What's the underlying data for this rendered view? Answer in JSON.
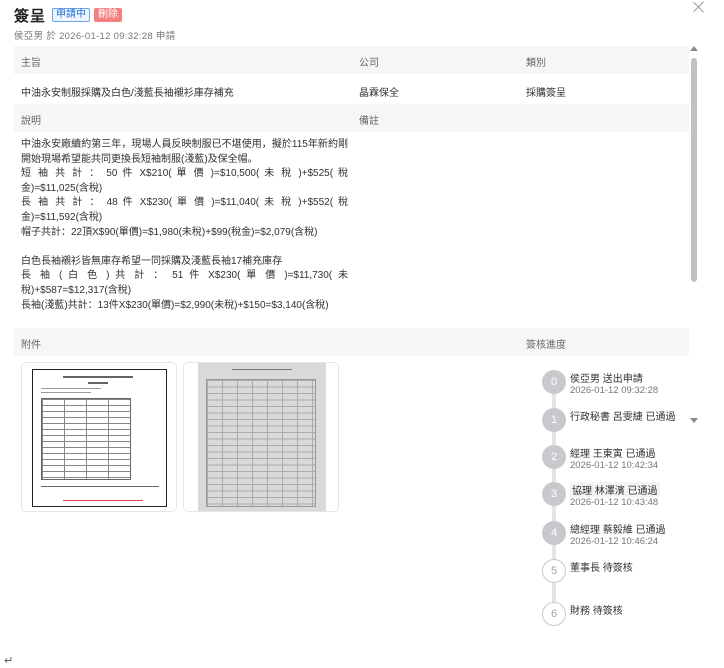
{
  "header": {
    "title": "簽呈",
    "status_tag": "申請中",
    "delete_label": "刪除",
    "subtitle": "侯亞男 於 2026-01-12 09:32:28 申請"
  },
  "info": {
    "subject_label": "主旨",
    "company_label": "公司",
    "category_label": "類別",
    "subject_value": "中油永安制服採購及白色/淺藍長袖襯衫庫存補充",
    "company_value": "晶霖保全",
    "category_value": "採購簽呈",
    "description_label": "說明",
    "remarks_label": "備註"
  },
  "description": {
    "lines": [
      "中油永安廠續約第三年，現場人員反映制服已不堪使用，擬於115年新約剛開始現場希望能共同更換長短袖制服(淺藍)及保全帽。",
      "短 袖 共 計 ： 50 件 X$210( 單 價 )=$10,500( 未 稅 )+$525( 稅 金)=$11,025(含稅)",
      "長 袖 共 計 ： 48 件 X$230( 單 價 )=$11,040( 未 稅 )+$552( 稅 金)=$11,592(含稅)",
      "帽子共計：22頂X$90(單價)=$1,980(未稅)+$99(稅金)=$2,079(含稅)",
      "白色長袖襯衫皆無庫存希望一同採購及淺藍長袖17補充庫存",
      "長 袖 ( 白 色 ) 共 計 ： 51 件 X$230( 單 價 )=$11,730( 未 稅)+$587=$12,317(含稅)",
      "長袖(淺藍)共計：13件X$230(單價)=$2,990(未稅)+$150=$3,140(含稅)"
    ]
  },
  "attachments": {
    "label": "附件"
  },
  "progress": {
    "label": "簽核進度",
    "steps": [
      {
        "index": "0",
        "text": "侯亞男 送出申請",
        "time": "2026-01-12 09:32:28"
      },
      {
        "index": "1",
        "text": "行政秘書 呂雯緁 已通過",
        "time": ""
      },
      {
        "index": "2",
        "text": "經理 王東寅 已通過",
        "time": "2026-01-12 10:42:34"
      },
      {
        "index": "3",
        "text": "協理 林澤濱 已通過",
        "time": "2026-01-12 10:43:48"
      },
      {
        "index": "4",
        "text": "總經理 蔡毅維 已通過",
        "time": "2026-01-12 10:46:24"
      },
      {
        "index": "5",
        "text": "董事長 待簽核",
        "time": ""
      },
      {
        "index": "6",
        "text": "財務 待簽核",
        "time": ""
      }
    ]
  },
  "footer": {
    "return_symbol": "↵"
  }
}
